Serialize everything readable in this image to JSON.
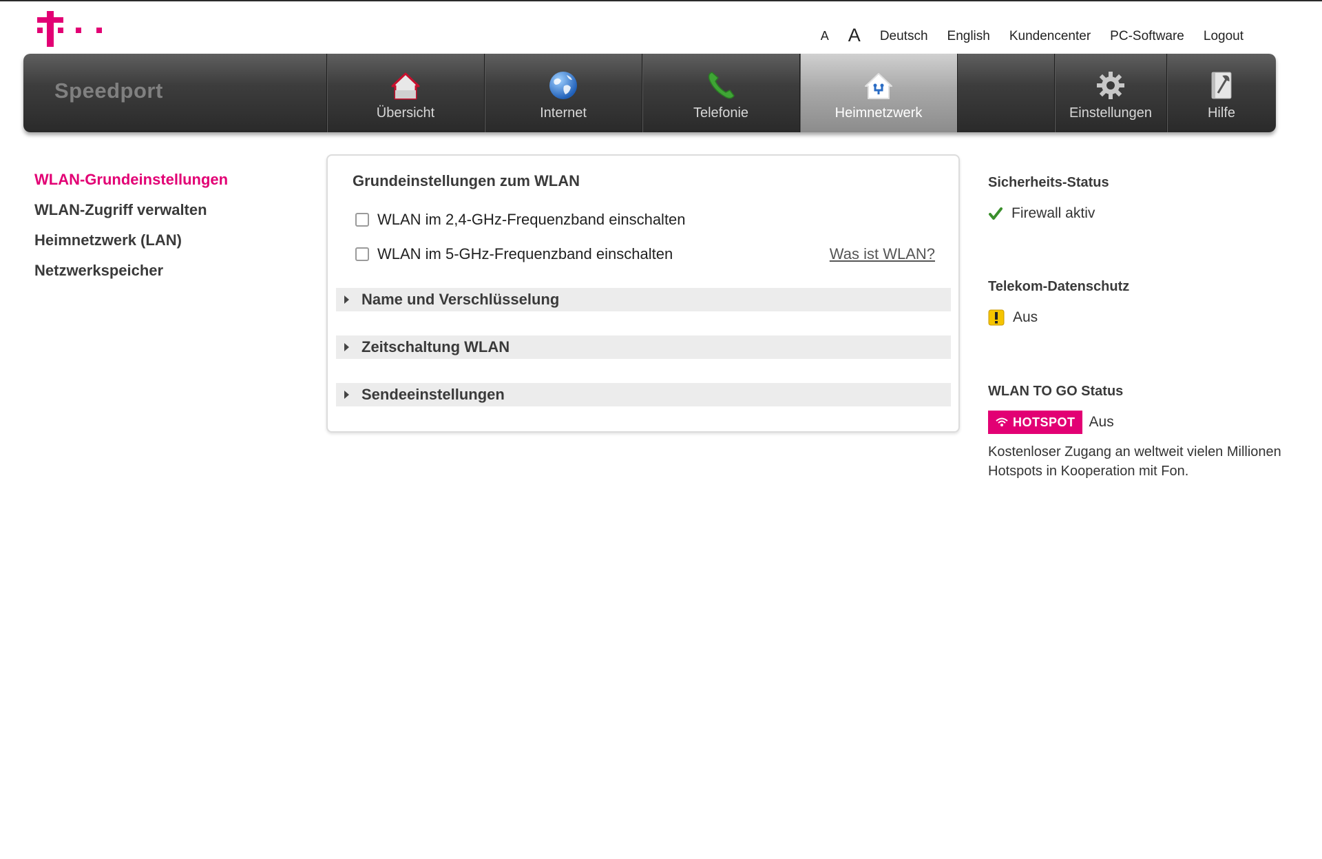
{
  "header": {
    "font_small_label": "A",
    "font_large_label": "A",
    "links": [
      "Deutsch",
      "English",
      "Kundencenter",
      "PC-Software",
      "Logout"
    ],
    "brand_color": "#e20074"
  },
  "navbar": {
    "brand": "Speedport",
    "items": [
      {
        "label": "Übersicht",
        "icon": "home-icon"
      },
      {
        "label": "Internet",
        "icon": "globe-icon"
      },
      {
        "label": "Telefonie",
        "icon": "phone-icon"
      },
      {
        "label": "Heimnetzwerk",
        "icon": "home-network-icon",
        "active": true
      },
      {
        "label": "Einstellungen",
        "icon": "gear-icon"
      },
      {
        "label": "Hilfe",
        "icon": "help-book-icon"
      }
    ]
  },
  "sidebar": {
    "items": [
      {
        "label": "WLAN-Grundeinstellungen",
        "active": true
      },
      {
        "label": "WLAN-Zugriff verwalten"
      },
      {
        "label": "Heimnetzwerk (LAN)"
      },
      {
        "label": "Netzwerkspeicher"
      }
    ]
  },
  "main": {
    "title": "Grundeinstellungen zum WLAN",
    "checkboxes": [
      {
        "label": "WLAN im 2,4-GHz-Frequenzband einschalten",
        "checked": false
      },
      {
        "label": "WLAN im 5-GHz-Frequenzband einschalten",
        "checked": false
      }
    ],
    "help_link": "Was ist WLAN?",
    "sections": [
      "Name und Verschlüsselung",
      "Zeitschaltung WLAN",
      "Sendeeinstellungen"
    ]
  },
  "status": {
    "security_title": "Sicherheits-Status",
    "security_value": "Firewall aktiv",
    "privacy_title": "Telekom-Datenschutz",
    "privacy_value": "Aus",
    "wlan_to_go_title": "WLAN TO GO Status",
    "hotspot_badge": "HOTSPOT",
    "wlan_to_go_value": "Aus",
    "wlan_to_go_description": "Kostenloser Zugang an weltweit vielen Millionen Hotspots in Kooperation mit Fon."
  }
}
